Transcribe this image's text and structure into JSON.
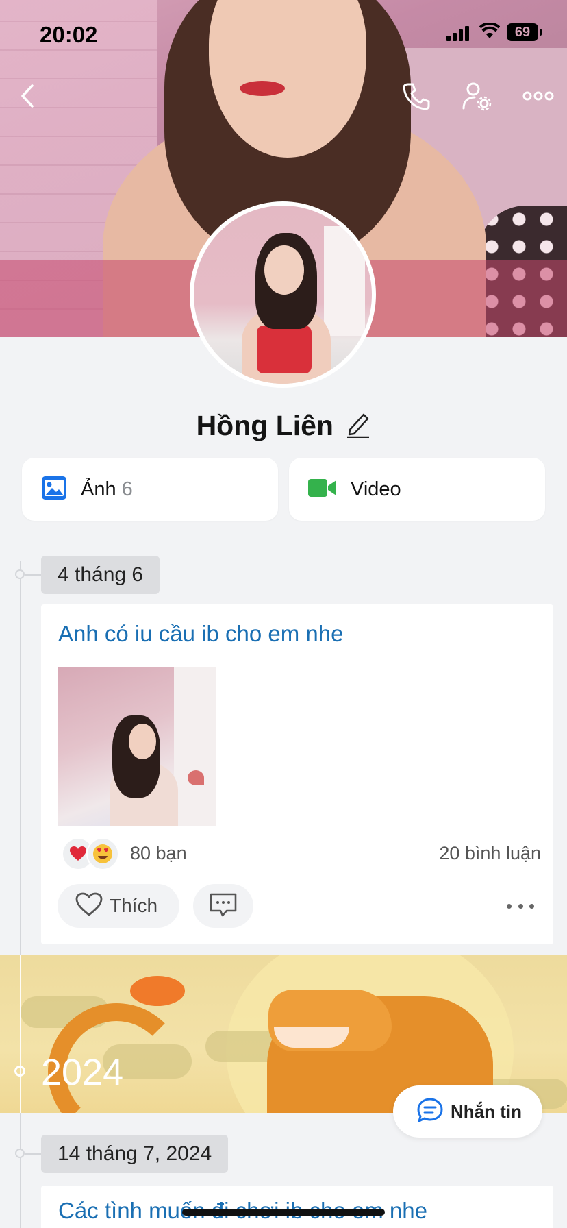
{
  "status_bar": {
    "time": "20:02",
    "battery": "69"
  },
  "profile": {
    "name": "Hồng Liên"
  },
  "media": {
    "photos_label": "Ảnh",
    "photos_count": "6",
    "video_label": "Video"
  },
  "timeline": {
    "entry1_date": "4 tháng 6",
    "post1": {
      "text": "Anh có iu cầu ib cho em nhe",
      "reactions_count": "80 bạn",
      "comments_count": "20 bình luận",
      "like_label": "Thích"
    },
    "year_label": "2024",
    "entry2_date": "14 tháng 7, 2024",
    "post2": {
      "text": "Các tình muốn đi chơi ib cho em nhe"
    }
  },
  "chat_button": {
    "label": "Nhắn tin"
  },
  "colors": {
    "accent": "#1a6fb3",
    "photo_icon": "#1a73e8",
    "video_icon": "#34b24c",
    "heart": "#e0293a"
  },
  "icons": [
    "back-icon",
    "phone-icon",
    "user-settings-icon",
    "more-icon",
    "edit-icon",
    "photo-icon",
    "video-icon",
    "heart-icon",
    "comment-icon",
    "chat-icon"
  ]
}
